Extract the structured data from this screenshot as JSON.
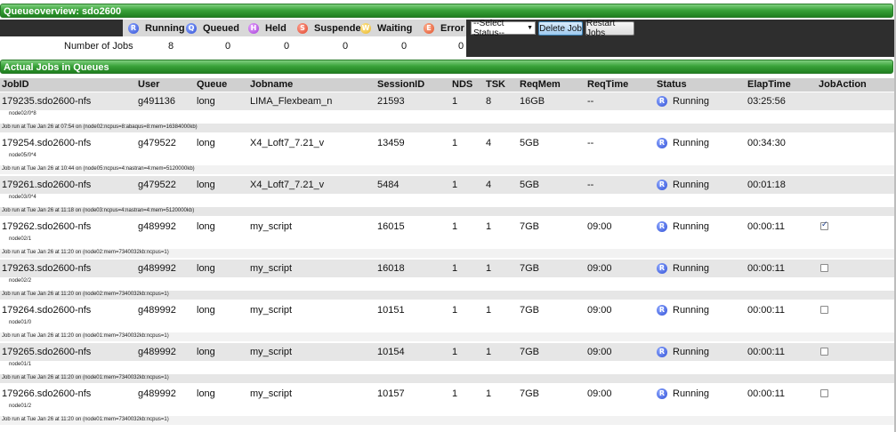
{
  "queue_overview": {
    "title": "Queueoverview:   sdo2600",
    "statuses": [
      {
        "label": "Running",
        "icon": "running-badge-icon",
        "letter": "R",
        "color": "#2f4fd6",
        "count": "8"
      },
      {
        "label": "Queued",
        "icon": "queued-badge-icon",
        "letter": "Q",
        "color": "#2f4fd6",
        "count": "0"
      },
      {
        "label": "Held",
        "icon": "held-badge-icon",
        "letter": "H",
        "color": "#a43bd6",
        "count": "0"
      },
      {
        "label": "Suspended",
        "icon": "suspended-badge-icon",
        "letter": "S",
        "color": "#e0442a",
        "count": "0"
      },
      {
        "label": "Waiting",
        "icon": "waiting-badge-icon",
        "letter": "W",
        "color": "#e8b62a",
        "count": "0"
      },
      {
        "label": "Error",
        "icon": "error-badge-icon",
        "letter": "E",
        "color": "#e0502a",
        "count": "0"
      }
    ],
    "number_of_jobs_label": "Number of Jobs",
    "select_status": "--Select Status--",
    "delete_button": "Delete Job",
    "restart_button": "Restart Jobs"
  },
  "actual_jobs": {
    "title": "Actual Jobs in Queues",
    "columns": [
      "JobID",
      "User",
      "Queue",
      "Jobname",
      "SessionID",
      "NDS",
      "TSK",
      "ReqMem",
      "ReqTime",
      "Status",
      "ElapTime",
      "JobAction"
    ],
    "rows": [
      {
        "jobid": "179235.sdo2600-nfs",
        "user": "g491136",
        "queue": "long",
        "jobname": "LIMA_Flexbeam_n",
        "session": "21593",
        "nds": "1",
        "tsk": "8",
        "reqmem": "16GB",
        "reqtime": "--",
        "status": "Running",
        "elap": "03:25:56",
        "checkbox": "none",
        "node": "node02/0*8",
        "run": "Job run at Tue Jan 26 at 07:54 on (node02:ncpus=8:abaqus=8:mem=16384000kb)"
      },
      {
        "jobid": "179254.sdo2600-nfs",
        "user": "g479522",
        "queue": "long",
        "jobname": "X4_Loft7_7.21_v",
        "session": "13459",
        "nds": "1",
        "tsk": "4",
        "reqmem": "5GB",
        "reqtime": "--",
        "status": "Running",
        "elap": "00:34:30",
        "checkbox": "none",
        "node": "node05/0*4",
        "run": "Job run at Tue Jan 26 at 10:44 on (node05:ncpus=4:nastran=4:mem=5120000kb)"
      },
      {
        "jobid": "179261.sdo2600-nfs",
        "user": "g479522",
        "queue": "long",
        "jobname": "X4_Loft7_7.21_v",
        "session": "5484",
        "nds": "1",
        "tsk": "4",
        "reqmem": "5GB",
        "reqtime": "--",
        "status": "Running",
        "elap": "00:01:18",
        "checkbox": "none",
        "node": "node03/0*4",
        "run": "Job run at Tue Jan 26 at 11:18 on (node03:ncpus=4:nastran=4:mem=5120000kb)"
      },
      {
        "jobid": "179262.sdo2600-nfs",
        "user": "g489992",
        "queue": "long",
        "jobname": "my_script",
        "session": "16015",
        "nds": "1",
        "tsk": "1",
        "reqmem": "7GB",
        "reqtime": "09:00",
        "status": "Running",
        "elap": "00:00:11",
        "checkbox": "checked",
        "node": "node02/1",
        "run": "Job run at Tue Jan 26 at 11:20 on (node02:mem=7340032kb:ncpus=1)"
      },
      {
        "jobid": "179263.sdo2600-nfs",
        "user": "g489992",
        "queue": "long",
        "jobname": "my_script",
        "session": "16018",
        "nds": "1",
        "tsk": "1",
        "reqmem": "7GB",
        "reqtime": "09:00",
        "status": "Running",
        "elap": "00:00:11",
        "checkbox": "unchecked",
        "node": "node02/2",
        "run": "Job run at Tue Jan 26 at 11:20 on (node02:mem=7340032kb:ncpus=1)"
      },
      {
        "jobid": "179264.sdo2600-nfs",
        "user": "g489992",
        "queue": "long",
        "jobname": "my_script",
        "session": "10151",
        "nds": "1",
        "tsk": "1",
        "reqmem": "7GB",
        "reqtime": "09:00",
        "status": "Running",
        "elap": "00:00:11",
        "checkbox": "unchecked",
        "node": "node01/0",
        "run": "Job run at Tue Jan 26 at 11:20 on (node01:mem=7340032kb:ncpus=1)"
      },
      {
        "jobid": "179265.sdo2600-nfs",
        "user": "g489992",
        "queue": "long",
        "jobname": "my_script",
        "session": "10154",
        "nds": "1",
        "tsk": "1",
        "reqmem": "7GB",
        "reqtime": "09:00",
        "status": "Running",
        "elap": "00:00:11",
        "checkbox": "unchecked",
        "node": "node01/1",
        "run": "Job run at Tue Jan 26 at 11:20 on (node01:mem=7340032kb:ncpus=1)"
      },
      {
        "jobid": "179266.sdo2600-nfs",
        "user": "g489992",
        "queue": "long",
        "jobname": "my_script",
        "session": "10157",
        "nds": "1",
        "tsk": "1",
        "reqmem": "7GB",
        "reqtime": "09:00",
        "status": "Running",
        "elap": "00:00:11",
        "checkbox": "unchecked",
        "node": "node01/2",
        "run": "Job run at Tue Jan 26 at 11:20 on (node01:mem=7340032kb:ncpus=1)"
      }
    ]
  }
}
